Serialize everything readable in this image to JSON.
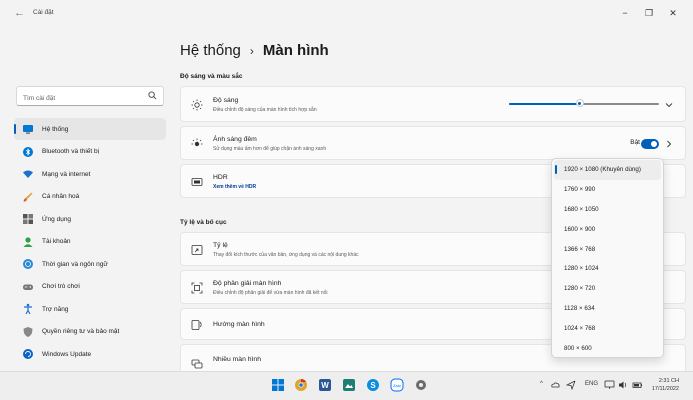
{
  "window": {
    "title": "Cài đặt",
    "minimize": "−",
    "maximize": "❐",
    "close": "✕",
    "back": "←"
  },
  "sidebar": {
    "search_placeholder": "Tìm cài đặt",
    "items": [
      {
        "label": "Hệ thống",
        "icon": "monitor-icon",
        "active": true
      },
      {
        "label": "Bluetooth và thiết bị",
        "icon": "bluetooth-icon"
      },
      {
        "label": "Mạng và internet",
        "icon": "wifi-icon"
      },
      {
        "label": "Cá nhân hoá",
        "icon": "brush-icon"
      },
      {
        "label": "Ứng dụng",
        "icon": "apps-icon"
      },
      {
        "label": "Tài khoản",
        "icon": "person-icon"
      },
      {
        "label": "Thời gian và ngôn ngữ",
        "icon": "globe-clock-icon"
      },
      {
        "label": "Chơi trò chơi",
        "icon": "gamepad-icon"
      },
      {
        "label": "Trợ năng",
        "icon": "accessibility-icon"
      },
      {
        "label": "Quyền riêng tư và bảo mật",
        "icon": "shield-icon"
      },
      {
        "label": "Windows Update",
        "icon": "update-icon"
      }
    ]
  },
  "main": {
    "breadcrumb_parent": "Hệ thống",
    "breadcrumb_sep": "›",
    "breadcrumb_current": "Màn hình",
    "section1_title": "Độ sáng và màu sắc",
    "section2_title": "Tỷ lệ và bố cục",
    "brightness": {
      "title": "Độ sáng",
      "subtitle": "Điều chỉnh độ sáng của màn hình tích hợp sẵn",
      "level": 0.47
    },
    "night_light": {
      "title": "Ánh sáng đêm",
      "subtitle": "Sử dụng màu ấm hơn để giúp chặn ánh sáng xanh",
      "state": "Bật"
    },
    "hdr": {
      "title": "HDR",
      "link": "Xem thêm về HDR"
    },
    "scale": {
      "title": "Tỷ lệ",
      "subtitle": "Thay đổi kích thước của văn bản, ứng dụng và các nội dung khác"
    },
    "resolution": {
      "title": "Độ phân giải màn hình",
      "subtitle": "Điều chỉnh độ phân giải để vừa màn hình đã kết nối"
    },
    "orientation": {
      "title": "Hướng màn hình"
    },
    "multi_display": {
      "title": "Nhiều màn hình"
    }
  },
  "resolution_options": [
    "1920 × 1080 (Khuyên dùng)",
    "1760 × 990",
    "1680 × 1050",
    "1600 × 900",
    "1366 × 768",
    "1280 × 1024",
    "1280 × 720",
    "1128 × 634",
    "1024 × 768",
    "800 × 600"
  ],
  "selected_resolution": "1920 × 1080 (Khuyên dùng)",
  "taskbar": {
    "tray_caret": "^",
    "lang": "ENG",
    "time": "2:31 CH",
    "date": "17/11/2022"
  },
  "colors": {
    "accent": "#005fb8",
    "background": "#f3f3f3"
  }
}
